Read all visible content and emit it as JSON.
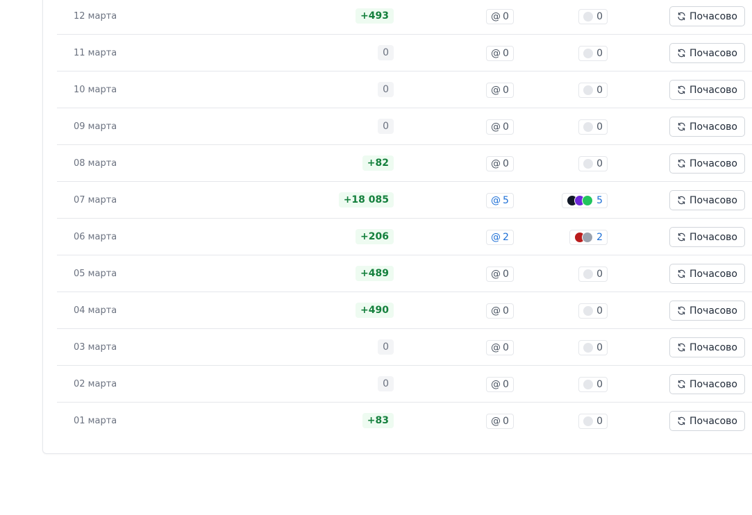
{
  "table": {
    "button_label": "Почасово",
    "rows": [
      {
        "date": "12 марта",
        "delta": "+493",
        "mentions": "0",
        "reactions": "0",
        "avatars": []
      },
      {
        "date": "11 марта",
        "delta": "0",
        "mentions": "0",
        "reactions": "0",
        "avatars": []
      },
      {
        "date": "10 марта",
        "delta": "0",
        "mentions": "0",
        "reactions": "0",
        "avatars": []
      },
      {
        "date": "09 марта",
        "delta": "0",
        "mentions": "0",
        "reactions": "0",
        "avatars": []
      },
      {
        "date": "08 марта",
        "delta": "+82",
        "mentions": "0",
        "reactions": "0",
        "avatars": []
      },
      {
        "date": "07 марта",
        "delta": "+18 085",
        "mentions": "5",
        "reactions": "5",
        "avatars": [
          "#111827",
          "#6d28d9",
          "#22c55e"
        ]
      },
      {
        "date": "06 марта",
        "delta": "+206",
        "mentions": "2",
        "reactions": "2",
        "avatars": [
          "#b91c1c",
          "#9ca3af"
        ]
      },
      {
        "date": "05 марта",
        "delta": "+489",
        "mentions": "0",
        "reactions": "0",
        "avatars": []
      },
      {
        "date": "04 марта",
        "delta": "+490",
        "mentions": "0",
        "reactions": "0",
        "avatars": []
      },
      {
        "date": "03 марта",
        "delta": "0",
        "mentions": "0",
        "reactions": "0",
        "avatars": []
      },
      {
        "date": "02 марта",
        "delta": "0",
        "mentions": "0",
        "reactions": "0",
        "avatars": []
      },
      {
        "date": "01 марта",
        "delta": "+83",
        "mentions": "0",
        "reactions": "0",
        "avatars": []
      }
    ]
  },
  "colors": {
    "positive": "#15803d",
    "positive_bg": "#eefbf1",
    "link": "#1d6fd6",
    "border": "#e5e7eb"
  },
  "icons": {
    "mention": "at-icon",
    "button": "refresh-icon",
    "reaction_empty": "empty-reaction-icon"
  }
}
